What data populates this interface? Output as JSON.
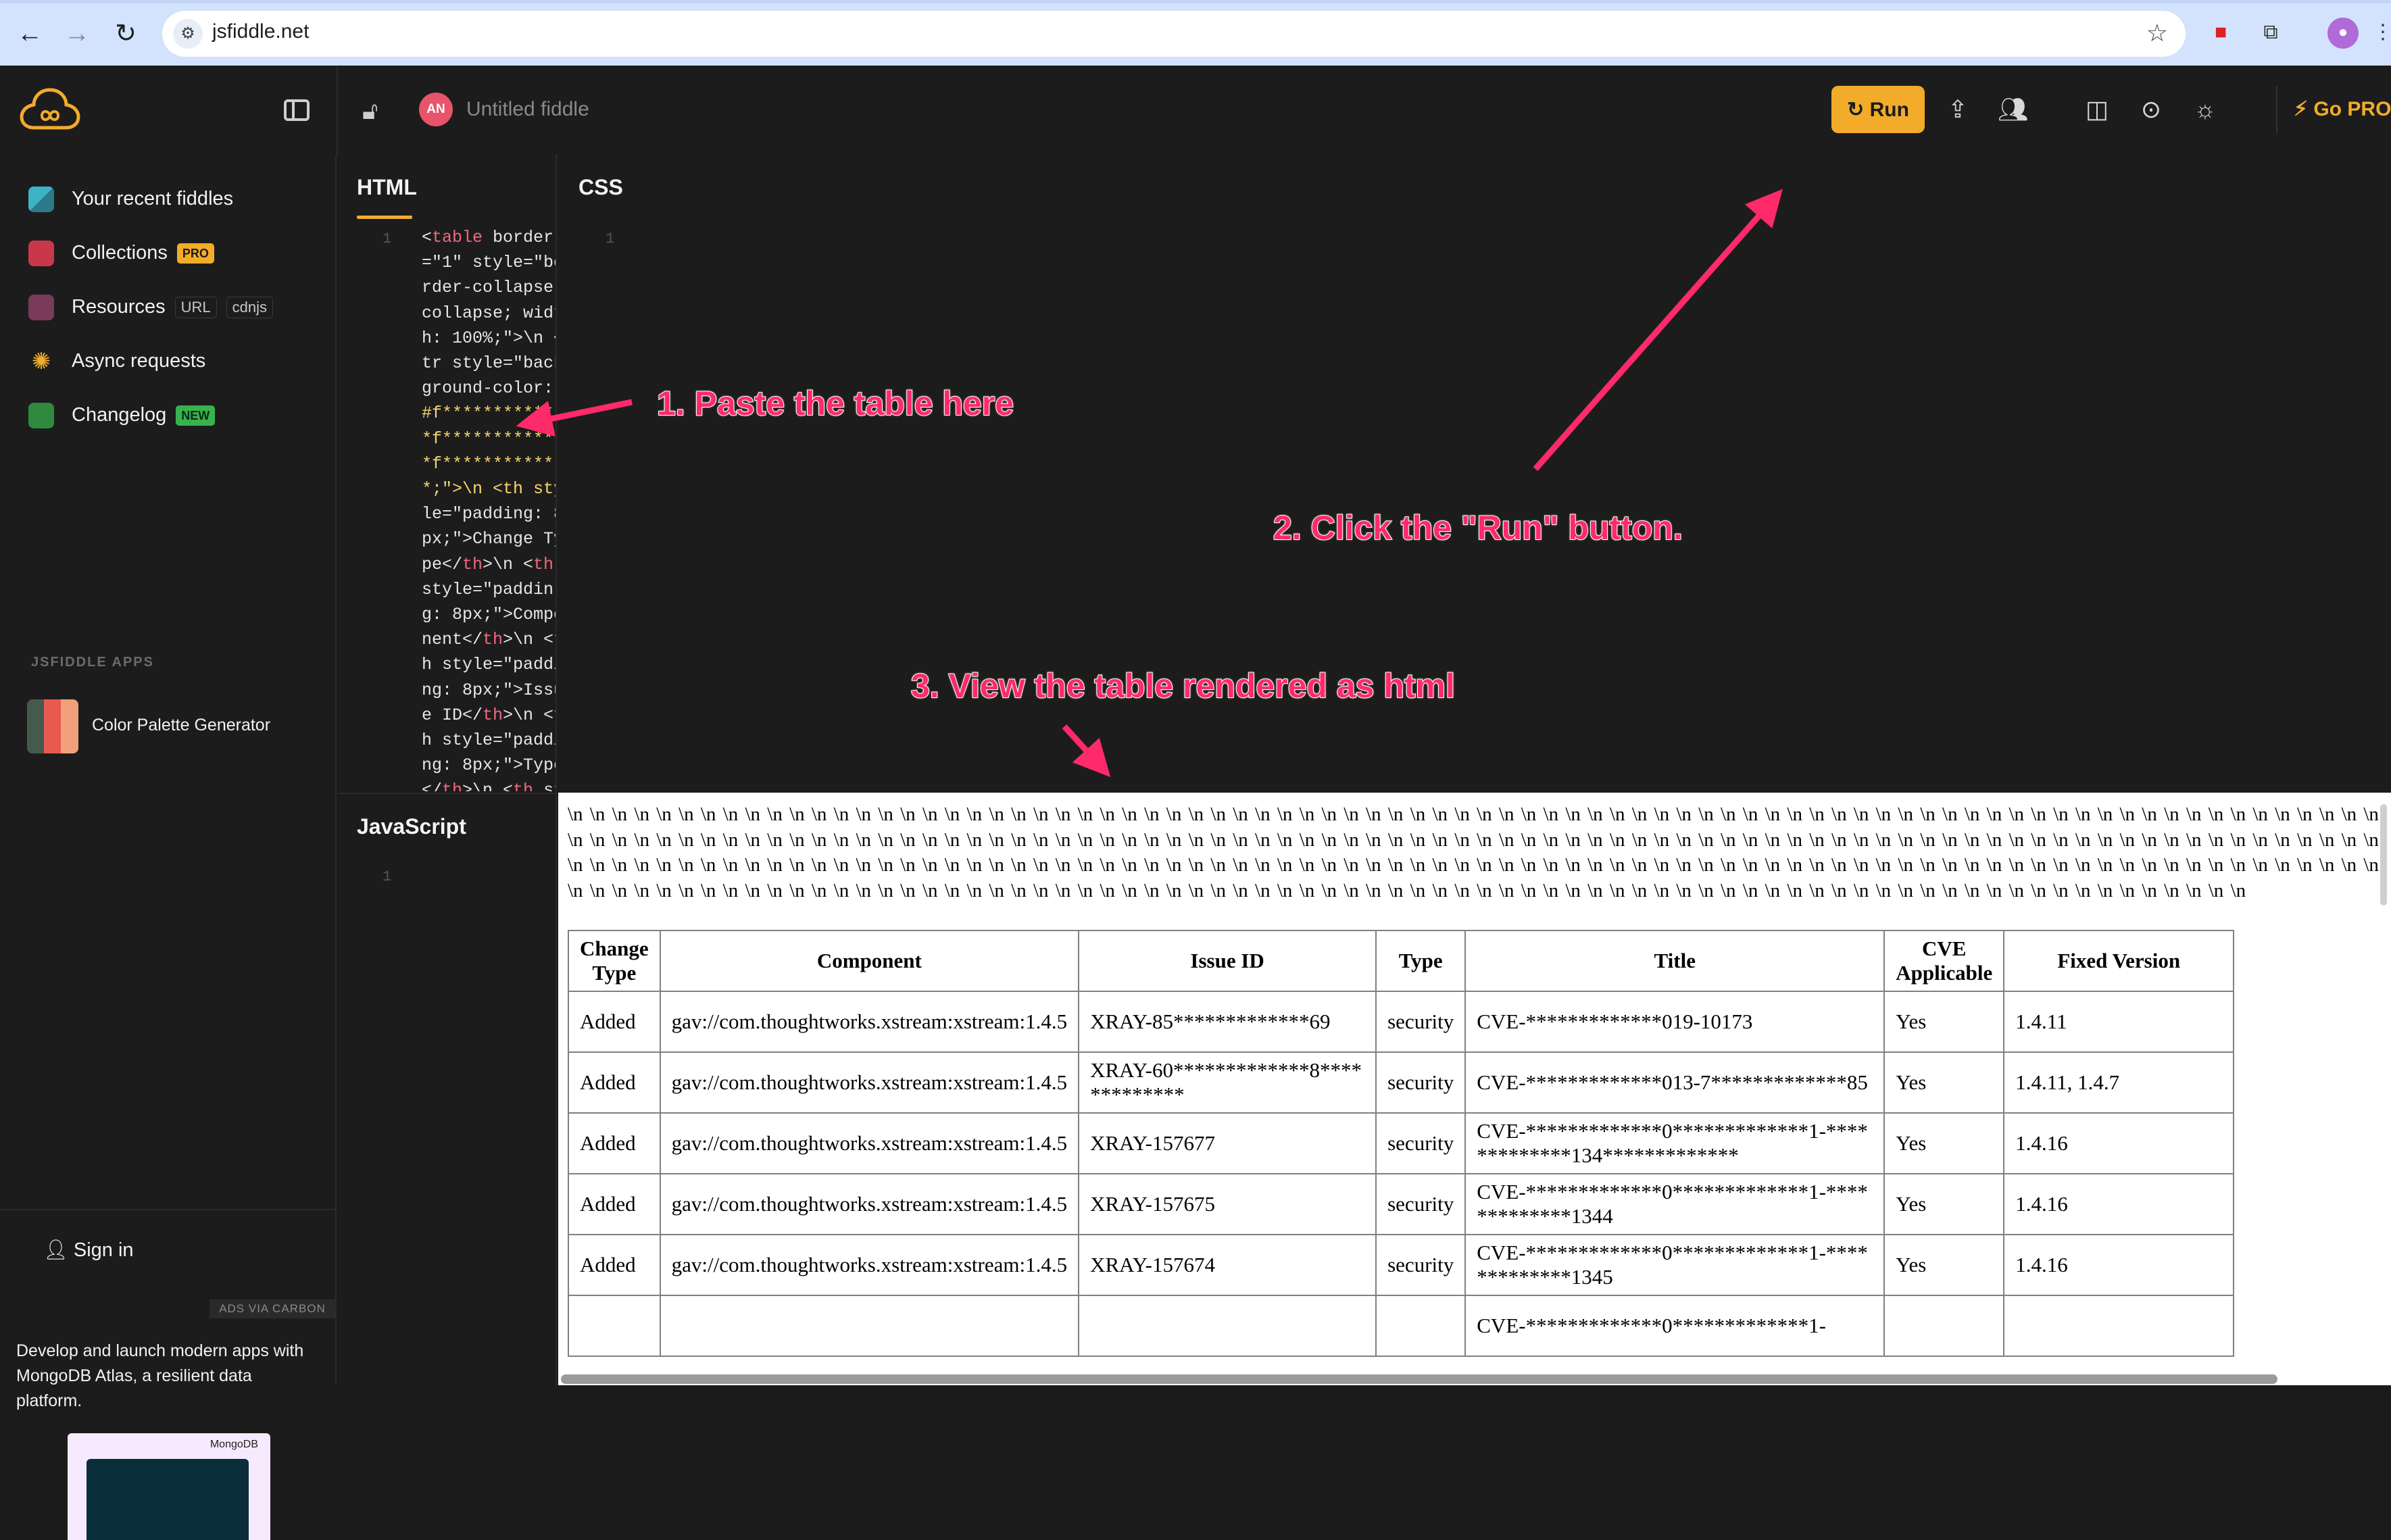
{
  "browser": {
    "url": "jsfiddle.net"
  },
  "header": {
    "avatar_initials": "AN",
    "fiddle_title": "Untitled fiddle",
    "run_label": "Run",
    "gopro_label": "Go PRO",
    "accent_color": "#f2ac2a"
  },
  "sidebar": {
    "items": [
      {
        "label": "Your recent fiddles",
        "badge": ""
      },
      {
        "label": "Collections",
        "badge": "PRO"
      },
      {
        "label": "Resources",
        "badge": "URL",
        "badge2": "cdnjs"
      },
      {
        "label": "Async requests",
        "badge": ""
      },
      {
        "label": "Changelog",
        "badge": "NEW"
      }
    ],
    "apps_heading": "JSFIDDLE APPS",
    "app_item": "Color Palette Generator",
    "sign_in": "Sign in",
    "ads_via": "ADS VIA CARBON",
    "ad_text": "Develop and launch modern apps with MongoDB Atlas, a resilient data platform.",
    "ad_brand": "MongoDB"
  },
  "panes": {
    "html": "HTML",
    "css": "CSS",
    "js": "JavaScript",
    "line_one": "1"
  },
  "code_lines": [
    "<table border",
    "=\"1\" style=\"bo",
    "rder-collapse",
    "collapse; widt",
    "h: 100%;\">\\n <",
    "tr style=\"back",
    "ground-color:",
    "#f************",
    "*f************",
    "*f************",
    "*;\">\\n <th sty",
    "le=\"padding: 8",
    "px;\">Change Ty",
    "pe</th>\\n <th",
    "style=\"paddin",
    "g: 8px;\">Compo",
    "nent</th>\\n <t",
    "h style=\"paddi",
    "ng: 8px;\">Issu",
    "e ID</th>\\n <t",
    "h style=\"paddi",
    "ng: 8px;\">Type",
    "</th>\\n <th st"
  ],
  "result": {
    "newline_text": "\\n \\n \\n \\n \\n \\n \\n \\n \\n \\n \\n \\n \\n \\n \\n \\n \\n \\n \\n \\n \\n \\n \\n \\n \\n \\n \\n \\n \\n \\n \\n \\n \\n \\n \\n \\n \\n \\n \\n \\n \\n \\n \\n \\n \\n \\n \\n \\n \\n \\n \\n \\n \\n \\n \\n \\n \\n \\n \\n \\n \\n \\n \\n \\n \\n \\n \\n \\n \\n \\n \\n \\n \\n \\n \\n \\n \\n \\n \\n \\n \\n \\n \\n \\n \\n \\n \\n \\n \\n \\n \\n \\n \\n \\n \\n \\n \\n \\n \\n \\n \\n \\n \\n \\n \\n \\n \\n \\n \\n \\n \\n \\n \\n \\n \\n \\n \\n \\n \\n \\n \\n \\n \\n \\n \\n \\n \\n \\n \\n \\n \\n \\n \\n \\n \\n \\n \\n \\n \\n \\n \\n \\n \\n \\n \\n \\n \\n \\n \\n \\n \\n \\n \\n \\n \\n \\n \\n \\n \\n \\n \\n \\n \\n \\n \\n \\n \\n \\n \\n \\n \\n \\n \\n \\n \\n \\n \\n \\n \\n \\n \\n \\n \\n \\n \\n \\n \\n \\n \\n \\n \\n \\n \\n \\n \\n \\n \\n \\n \\n \\n \\n \\n \\n \\n \\n \\n \\n \\n \\n \\n \\n \\n \\n \\n \\n \\n \\n \\n \\n \\n \\n \\n \\n \\n \\n \\n \\n \\n \\n \\n \\n \\n \\n \\n \\n \\n \\n \\n \\n \\n \\n \\n \\n \\n \\n \\n \\n \\n \\n \\n \\n \\n \\n \\n \\n \\n \\n \\n \\n \\n \\n \\n \\n \\n \\n \\n \\n \\n \\n \\n \\n \\n \\n \\n \\n \\n \\n \\n \\n \\n \\n \\n \\n \\n \\n \\n \\n \\n \\n \\n \\n \\n \\n \\n \\n \\n \\n \\n \\n \\n \\n \\n \\n \\n \\n \\n \\n \\n \\n \\n \\n \\n \\n \\n \\n \\n \\n \\n \\n \\n \\n \\n",
    "columns": [
      "Change Type",
      "Component",
      "Issue ID",
      "Type",
      "Title",
      "CVE Applicable",
      "Fixed Version"
    ],
    "rows": [
      [
        "Added",
        "gav://com.thoughtworks.xstream:xstream:1.4.5",
        "XRAY-85*************69",
        "security",
        "CVE-*************019-10173",
        "Yes",
        "1.4.11"
      ],
      [
        "Added",
        "gav://com.thoughtworks.xstream:xstream:1.4.5",
        "XRAY-60*************8*************",
        "security",
        "CVE-*************013-7*************85",
        "Yes",
        "1.4.11, 1.4.7"
      ],
      [
        "Added",
        "gav://com.thoughtworks.xstream:xstream:1.4.5",
        "XRAY-157677",
        "security",
        "CVE-*************0*************1-*************134*************",
        "Yes",
        "1.4.16"
      ],
      [
        "Added",
        "gav://com.thoughtworks.xstream:xstream:1.4.5",
        "XRAY-157675",
        "security",
        "CVE-*************0*************1-*************1344",
        "Yes",
        "1.4.16"
      ],
      [
        "Added",
        "gav://com.thoughtworks.xstream:xstream:1.4.5",
        "XRAY-157674",
        "security",
        "CVE-*************0*************1-*************1345",
        "Yes",
        "1.4.16"
      ],
      [
        "",
        "",
        "",
        "",
        "CVE-*************0*************1-",
        "",
        ""
      ]
    ]
  },
  "annotations": {
    "step1": "1. Paste the table here",
    "step2": "2. Click the \"Run\" button.",
    "step3": "3. View the table rendered as html",
    "color": "#ff2a6a"
  }
}
